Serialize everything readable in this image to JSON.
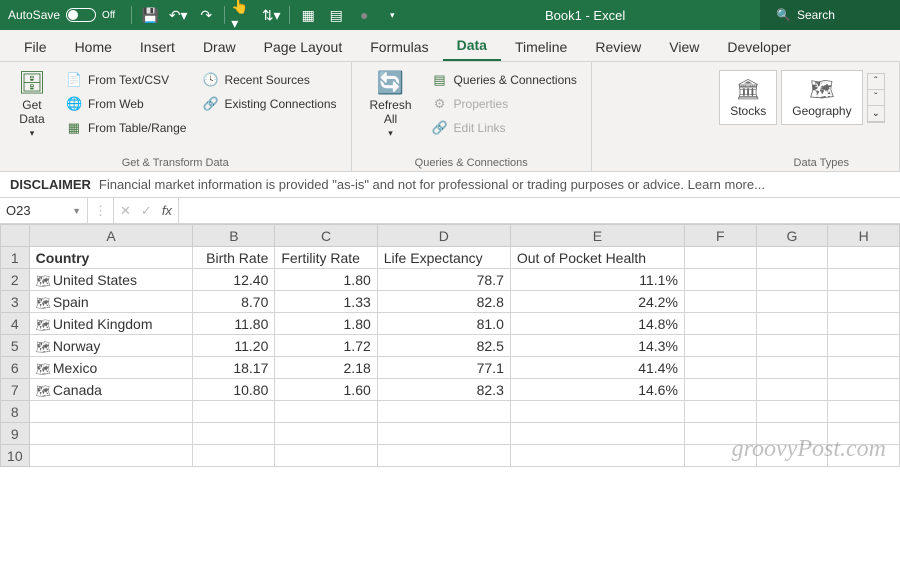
{
  "titlebar": {
    "autosave_label": "AutoSave",
    "autosave_state": "Off",
    "title": "Book1  -  Excel",
    "search_label": "Search"
  },
  "tabs": [
    "File",
    "Home",
    "Insert",
    "Draw",
    "Page Layout",
    "Formulas",
    "Data",
    "Timeline",
    "Review",
    "View",
    "Developer"
  ],
  "active_tab": "Data",
  "ribbon": {
    "get_data": "Get\nData",
    "from_text": "From Text/CSV",
    "from_web": "From Web",
    "from_table": "From Table/Range",
    "recent_sources": "Recent Sources",
    "existing_conn": "Existing Connections",
    "group1": "Get & Transform Data",
    "refresh_all": "Refresh\nAll",
    "queries_conn": "Queries & Connections",
    "properties": "Properties",
    "edit_links": "Edit Links",
    "group2": "Queries & Connections",
    "stocks": "Stocks",
    "geography": "Geography",
    "group3": "Data Types"
  },
  "disclaimer": {
    "label": "DISCLAIMER",
    "text": "Financial market information is provided \"as-is\" and not for professional or trading purposes or advice. Learn more..."
  },
  "name_box": "O23",
  "fx": "fx",
  "columns": {
    "A": "A",
    "B": "B",
    "C": "C",
    "D": "D",
    "E": "E",
    "F": "F",
    "G": "G",
    "H": "H"
  },
  "col_widths": {
    "A": 160,
    "B": 80,
    "C": 100,
    "D": 130,
    "E": 170,
    "F": 70,
    "G": 70,
    "H": 70
  },
  "headers": {
    "A": "Country",
    "B": "Birth Rate",
    "C": "Fertility Rate",
    "D": "Life Expectancy",
    "E": "Out of Pocket Health"
  },
  "rows": [
    {
      "country": "United States",
      "birth": "12.40",
      "fert": "1.80",
      "life": "78.7",
      "health": "11.1%"
    },
    {
      "country": "Spain",
      "birth": "8.70",
      "fert": "1.33",
      "life": "82.8",
      "health": "24.2%"
    },
    {
      "country": "United Kingdom",
      "birth": "11.80",
      "fert": "1.80",
      "life": "81.0",
      "health": "14.8%"
    },
    {
      "country": "Norway",
      "birth": "11.20",
      "fert": "1.72",
      "life": "82.5",
      "health": "14.3%"
    },
    {
      "country": "Mexico",
      "birth": "18.17",
      "fert": "2.18",
      "life": "77.1",
      "health": "41.4%"
    },
    {
      "country": "Canada",
      "birth": "10.80",
      "fert": "1.60",
      "life": "82.3",
      "health": "14.6%"
    }
  ],
  "row_numbers": [
    "1",
    "2",
    "3",
    "4",
    "5",
    "6",
    "7",
    "8",
    "9",
    "10"
  ],
  "watermark": "groovyPost.com"
}
